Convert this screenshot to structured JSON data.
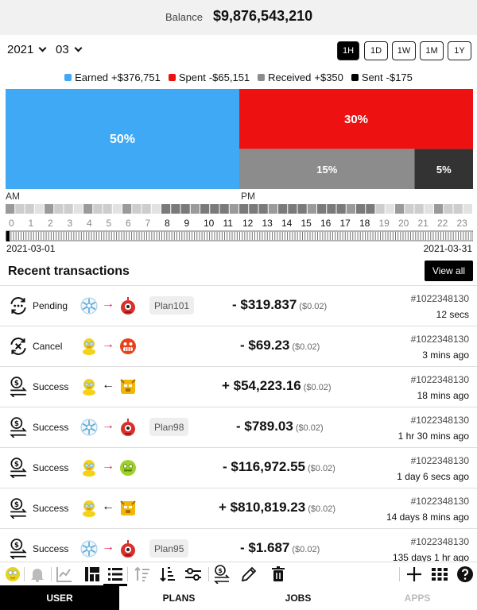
{
  "header": {
    "balance_label": "Balance",
    "balance_value": "$9,876,543,210"
  },
  "filters": {
    "year": "2021",
    "month": "03"
  },
  "range_buttons": [
    {
      "label": "1H",
      "active": true
    },
    {
      "label": "1D",
      "active": false
    },
    {
      "label": "1W",
      "active": false
    },
    {
      "label": "1M",
      "active": false
    },
    {
      "label": "1Y",
      "active": false
    }
  ],
  "legend": [
    {
      "name": "Earned",
      "value": "+$376,751",
      "color": "#3fa9f5"
    },
    {
      "name": "Spent",
      "value": "-$65,151",
      "color": "#ee1111"
    },
    {
      "name": "Received",
      "value": "+$350",
      "color": "#8c8c8c"
    },
    {
      "name": "Sent",
      "value": "-$175",
      "color": "#000000"
    }
  ],
  "chart_data": {
    "type": "treemap",
    "segments": [
      {
        "name": "Earned",
        "percent": 50,
        "label": "50%",
        "color": "#3fa9f5"
      },
      {
        "name": "Spent",
        "percent": 30,
        "label": "30%",
        "color": "#ee1111"
      },
      {
        "name": "Received",
        "percent": 15,
        "label": "15%",
        "color": "#8c8c8c"
      },
      {
        "name": "Sent",
        "percent": 5,
        "label": "5%",
        "color": "#333333"
      }
    ],
    "hours": {
      "am_label": "AM",
      "pm_label": "PM",
      "labels": [
        "0",
        "1",
        "2",
        "3",
        "4",
        "5",
        "6",
        "7",
        "8",
        "9",
        "10",
        "11",
        "12",
        "13",
        "14",
        "15",
        "16",
        "17",
        "18",
        "19",
        "20",
        "21",
        "22",
        "23"
      ],
      "intensity": [
        2,
        1,
        2,
        1,
        2,
        1,
        2,
        1,
        4,
        3,
        4,
        3,
        4,
        3,
        4,
        3,
        4,
        3,
        4,
        1,
        2,
        1,
        2,
        1
      ],
      "dim_labels": [
        0,
        1,
        2,
        3,
        4,
        5,
        6,
        7,
        19,
        20,
        21,
        22,
        23
      ]
    },
    "date_range": {
      "start": "2021-03-01",
      "end": "2021-03-31",
      "days": 31,
      "selected_day": 1
    }
  },
  "recent": {
    "title": "Recent transactions",
    "view_all": "View all"
  },
  "transactions": [
    {
      "status": "Pending",
      "status_icon": "pending-icon",
      "from": "snowflake-avatar",
      "to": "robot-avatar",
      "direction": "→",
      "dir": "out",
      "plan": "Plan101",
      "amount": "- $319.837",
      "fee": "($0.02)",
      "id": "#1022348130",
      "time": "12 secs"
    },
    {
      "status": "Cancel",
      "status_icon": "cancel-icon",
      "from": "duck-avatar",
      "to": "grin-avatar",
      "direction": "→",
      "dir": "out",
      "plan": "",
      "amount": "- $69.23",
      "fee": "($0.02)",
      "id": "#1022348130",
      "time": "3 mins ago"
    },
    {
      "status": "Success",
      "status_icon": "success-icon",
      "from": "duck-avatar",
      "to": "tiger-avatar",
      "direction": "←",
      "dir": "in",
      "plan": "",
      "amount": "+ $54,223.16",
      "fee": "($0.02)",
      "id": "#1022348130",
      "time": "18 mins ago"
    },
    {
      "status": "Success",
      "status_icon": "success-icon",
      "from": "snowflake-avatar",
      "to": "robot-avatar",
      "direction": "→",
      "dir": "out",
      "plan": "Plan98",
      "amount": "- $789.03",
      "fee": "($0.02)",
      "id": "#1022348130",
      "time": "1 hr 30 mins ago"
    },
    {
      "status": "Success",
      "status_icon": "success-icon",
      "from": "duck-avatar",
      "to": "alien-avatar",
      "direction": "→",
      "dir": "out",
      "plan": "",
      "amount": "- $116,972.55",
      "fee": "($0.02)",
      "id": "#1022348130",
      "time": "1 day 6 secs ago"
    },
    {
      "status": "Success",
      "status_icon": "success-icon",
      "from": "duck-avatar",
      "to": "tiger-avatar",
      "direction": "←",
      "dir": "in",
      "plan": "",
      "amount": "+ $810,819.23",
      "fee": "($0.02)",
      "id": "#1022348130",
      "time": "14 days 8 mins ago"
    },
    {
      "status": "Success",
      "status_icon": "success-icon",
      "from": "snowflake-avatar",
      "to": "robot-avatar",
      "direction": "→",
      "dir": "out",
      "plan": "Plan95",
      "amount": "- $1.687",
      "fee": "($0.02)",
      "id": "#1022348130",
      "time": "135 days 1 hr ago"
    }
  ],
  "toolbar": [
    {
      "icon": "user-avatar-icon",
      "active": false
    },
    {
      "icon": "bell-icon",
      "active": false
    },
    {
      "icon": "line-chart-icon",
      "active": false
    },
    {
      "icon": "treemap-icon",
      "active": false
    },
    {
      "icon": "list-icon",
      "active": true
    },
    {
      "icon": "sort-ascending-icon",
      "active": false
    },
    {
      "icon": "sort-descending-icon",
      "active": false
    },
    {
      "icon": "filter-sliders-icon",
      "active": false
    },
    {
      "icon": "transfer-money-icon",
      "active": false
    },
    {
      "icon": "pencil-icon",
      "active": false
    },
    {
      "icon": "trash-icon",
      "active": false
    },
    {
      "icon": "plus-icon",
      "active": false
    },
    {
      "icon": "grid-icon",
      "active": false
    },
    {
      "icon": "help-icon",
      "active": false
    }
  ],
  "tabs": [
    {
      "label": "USER",
      "active": true,
      "disabled": false
    },
    {
      "label": "PLANS",
      "active": false,
      "disabled": false
    },
    {
      "label": "JOBS",
      "active": false,
      "disabled": false
    },
    {
      "label": "APPS",
      "active": false,
      "disabled": true
    }
  ]
}
